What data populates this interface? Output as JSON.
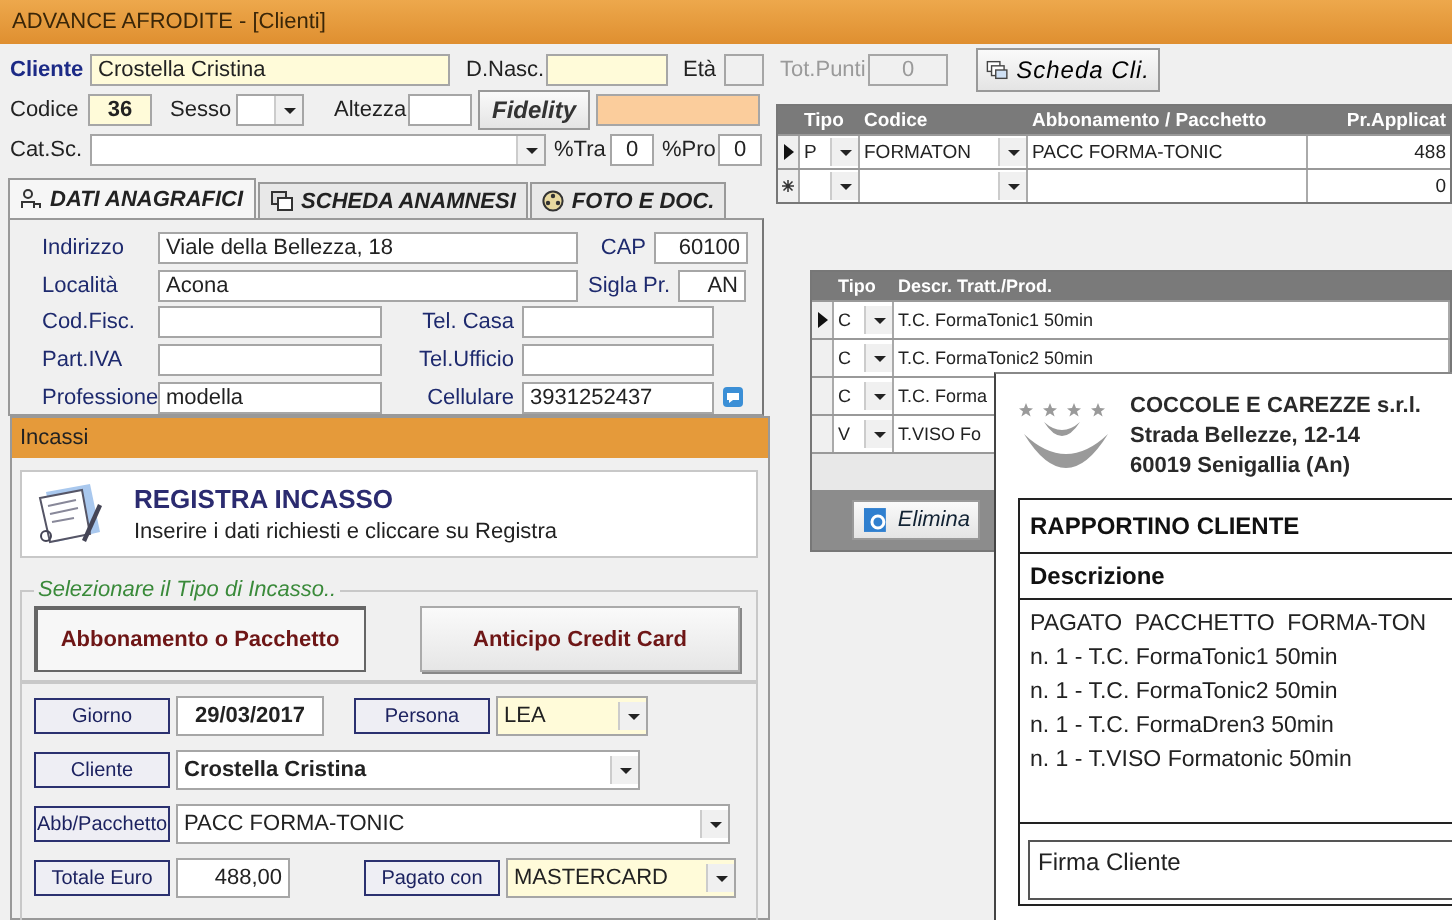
{
  "window": {
    "title": "ADVANCE AFRODITE - [Clienti]"
  },
  "client": {
    "label": "Cliente",
    "value": "Crostella Cristina"
  },
  "birth_date": {
    "label": "D.Nasc."
  },
  "age": {
    "label": "Età"
  },
  "total_points": {
    "label": "Tot.Punti",
    "value": "0",
    "disabled": true
  },
  "client_card_button": {
    "label": "Scheda Cli."
  },
  "code": {
    "label": "Codice",
    "value": "36"
  },
  "sex": {
    "label": "Sesso"
  },
  "height": {
    "label": "Altezza"
  },
  "fidelity_button": {
    "label": "Fidelity"
  },
  "category": {
    "label": "Cat.Sc."
  },
  "pct_tra": {
    "label": "%Tra",
    "value": "0"
  },
  "pct_pro": {
    "label": "%Pro",
    "value": "0"
  },
  "tabs": [
    {
      "label": "DATI ANAGRAFICI",
      "selected": true
    },
    {
      "label": "SCHEDA ANAMNESI",
      "selected": false
    },
    {
      "label": "FOTO E DOC.",
      "selected": false
    }
  ],
  "personal": [
    {
      "label": "Indirizzo",
      "value": "Viale della Bellezza, 18"
    },
    {
      "label": "CAP",
      "value": "60100"
    },
    {
      "label": "Località",
      "value": "Acona"
    },
    {
      "label": "Sigla Pr.",
      "value": "AN"
    },
    {
      "label": "Cod.Fisc."
    },
    {
      "label": "Tel. Casa"
    },
    {
      "label": "Part.IVA"
    },
    {
      "label": "Tel.Ufficio"
    },
    {
      "label": "Professione",
      "value": "modella"
    },
    {
      "label": "Cellulare",
      "value": "3931252437"
    }
  ],
  "packages_grid": {
    "columns": [
      "Tipo",
      "Codice",
      "Abbonamento / Pacchetto",
      "Pr.Applicat"
    ],
    "rows": [
      {
        "selected": true,
        "new": false,
        "tipo": "P",
        "codice": "FORMATON",
        "pacchetto": "PACC FORMA-TONIC",
        "prezzo": "488"
      },
      {
        "selected": false,
        "new": true,
        "prezzo": "0"
      }
    ]
  },
  "treatments_grid": {
    "columns": [
      "Tipo",
      "Descr. Tratt./Prod."
    ],
    "rows": [
      {
        "selected": true,
        "tipo": "C",
        "descr": "T.C. FormaTonic1 50min"
      },
      {
        "selected": false,
        "tipo": "C",
        "descr": "T.C. FormaTonic2 50min"
      },
      {
        "selected": false,
        "tipo": "C",
        "descr": "T.C. Forma"
      },
      {
        "selected": false,
        "tipo": "V",
        "descr": "T.VISO Fo"
      }
    ]
  },
  "delete_button": {
    "label": "Elimina"
  },
  "incassi": {
    "title": "Incassi",
    "banner": {
      "title": "REGISTRA INCASSO",
      "text": "Inserire i dati richiesti e cliccare su Registra"
    },
    "type_group": {
      "legend": "Selezionare il Tipo di Incasso..",
      "options": [
        {
          "label": "Abbonamento o Pacchetto",
          "selected": true
        },
        {
          "label": "Anticipo Credit Card",
          "selected": false
        }
      ]
    },
    "day": {
      "label": "Giorno",
      "value": "29/03/2017"
    },
    "person": {
      "label": "Persona",
      "value": "LEA"
    },
    "client": {
      "label": "Cliente",
      "value": "Crostella Cristina"
    },
    "package": {
      "label": "Abb/Pacchetto",
      "value": "PACC FORMA-TONIC"
    },
    "total": {
      "label": "Totale Euro",
      "value": "488,00"
    },
    "paid_with": {
      "label": "Pagato con",
      "value": "MASTERCARD"
    }
  },
  "receipt": {
    "company": [
      "COCCOLE E CAREZZE s.r.l.",
      "Strada Bellezze, 12-14",
      "60019 Senigallia (An)"
    ],
    "title": "RAPPORTINO CLIENTE",
    "column": "Descrizione",
    "lines": [
      "PAGATO  PACCHETTO  FORMA-TON",
      "n. 1 - T.C. FormaTonic1 50min",
      "n. 1 - T.C. FormaTonic2 50min",
      "n. 1 - T.C. FormaDren3 50min",
      "n. 1 - T.VISO Formatonic 50min"
    ],
    "signature": "Firma Cliente"
  }
}
